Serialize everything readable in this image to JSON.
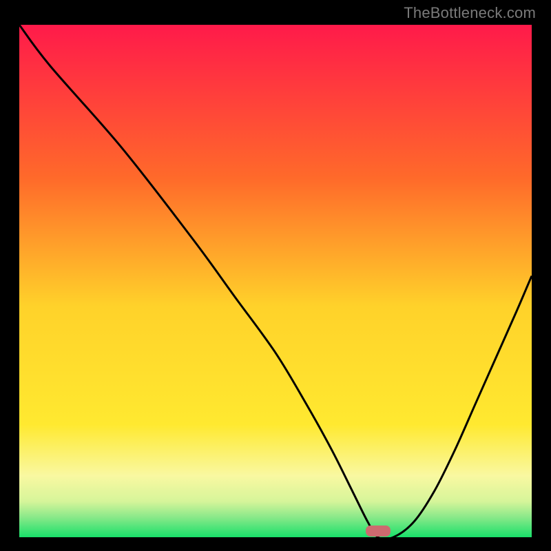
{
  "watermark": "TheBottleneck.com",
  "colors": {
    "red_top": "#ff1a4a",
    "orange_mid": "#ff9a2a",
    "yellow": "#ffe636",
    "pale_yellow": "#faf9a3",
    "pale_green": "#b6f3a1",
    "green": "#18e06a",
    "marker": "#cc6a6f",
    "curve": "#000000",
    "frame": "#000000"
  },
  "chart_data": {
    "type": "line",
    "title": "",
    "xlabel": "",
    "ylabel": "",
    "xlim": [
      0,
      100
    ],
    "ylim": [
      0,
      100
    ],
    "series": [
      {
        "name": "bottleneck-curve",
        "x": [
          0,
          6,
          20,
          34,
          42,
          50,
          56,
          61,
          65,
          68,
          70,
          73,
          77,
          81,
          85,
          89,
          93,
          97,
          100
        ],
        "values": [
          100,
          92,
          76,
          58,
          47,
          36,
          26,
          17,
          9,
          3,
          0,
          0,
          3,
          9,
          17,
          26,
          35,
          44,
          51
        ]
      }
    ],
    "marker": {
      "x": 70,
      "y": 1.2
    },
    "gradient_stops_pct": [
      {
        "offset": 0,
        "color": "#ff1a4a"
      },
      {
        "offset": 30,
        "color": "#ff6a2a"
      },
      {
        "offset": 55,
        "color": "#ffd22a"
      },
      {
        "offset": 78,
        "color": "#ffe930"
      },
      {
        "offset": 88,
        "color": "#f9f8a1"
      },
      {
        "offset": 93,
        "color": "#d6f59a"
      },
      {
        "offset": 96,
        "color": "#8ce98a"
      },
      {
        "offset": 100,
        "color": "#18e06a"
      }
    ]
  }
}
